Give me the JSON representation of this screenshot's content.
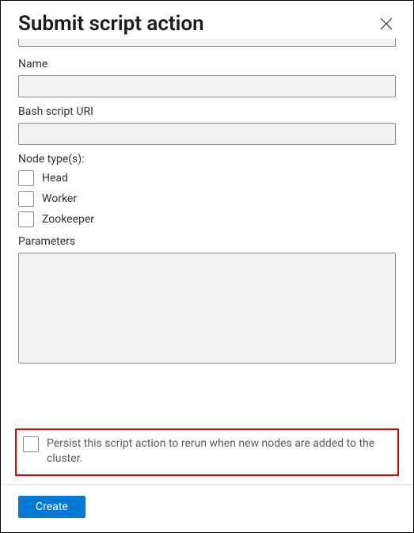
{
  "header": {
    "title": "Submit script action"
  },
  "fields": {
    "name_label": "Name",
    "name_value": "",
    "script_uri_label": "Bash script URI",
    "script_uri_value": "",
    "node_types_label": "Node type(s):",
    "node_types": {
      "head": {
        "label": "Head",
        "checked": false
      },
      "worker": {
        "label": "Worker",
        "checked": false
      },
      "zookeeper": {
        "label": "Zookeeper",
        "checked": false
      }
    },
    "parameters_label": "Parameters",
    "parameters_value": ""
  },
  "persist": {
    "label": "Persist this script action to rerun when new nodes are added to the cluster.",
    "checked": false
  },
  "footer": {
    "create_label": "Create"
  }
}
